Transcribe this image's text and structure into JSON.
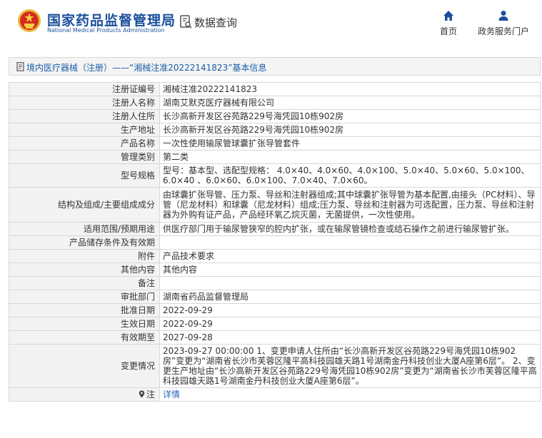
{
  "header": {
    "site_name": "国家药品监督管理局",
    "site_name_en": "National Medical Products Administration",
    "query_label": "数据查询",
    "nav": {
      "home": "首页",
      "service": "政务服务门户"
    }
  },
  "title": "境内医疗器械（注册）——“湘械注准20222141823”基本信息",
  "rows": [
    {
      "label": "注册证编号",
      "value": "湘械注准20222141823"
    },
    {
      "label": "注册人名称",
      "value": "湖南艾默克医疗器械有限公司"
    },
    {
      "label": "注册人住所",
      "value": "长沙高新开发区谷苑路229号海凭园10栋902房"
    },
    {
      "label": "生产地址",
      "value": "长沙高新开发区谷苑路229号海凭园10栋902房"
    },
    {
      "label": "产品名称",
      "value": "一次性使用输尿管球囊扩张导管套件"
    },
    {
      "label": "管理类别",
      "value": "第二类"
    },
    {
      "label": "型号规格",
      "value": "型号：基本型、选配型规格： 4.0×40、4.0×60、4.0×100、5.0×40、5.0×60、5.0×100、6.0×40 、6.0×60、6.0×100、7.0×40、7.0×60。"
    },
    {
      "label": "结构及组成/主要组成成分",
      "value": "由球囊扩张导管、压力泵、导丝和注射器组成;其中球囊扩张导管为基本配置,由接头（PC材料）、导管（尼龙材料）和球囊（尼龙材料）组成;压力泵、导丝和注射器为可选配置，压力泵、导丝和注射器为外购有证产品，产品经环氧乙烷灭菌，无菌提供，一次性使用。"
    },
    {
      "label": "适用范围/预期用途",
      "value": "供医疗部门用于输尿管狭窄的腔内扩张，或在输尿管镜检查或结石操作之前进行输尿管扩张。"
    },
    {
      "label": "产品储存条件及有效期",
      "value": ""
    },
    {
      "label": "附件",
      "value": "产品技术要求"
    },
    {
      "label": "其他内容",
      "value": "其他内容"
    },
    {
      "label": "备注",
      "value": ""
    },
    {
      "label": "审批部门",
      "value": "湖南省药品监督管理局"
    },
    {
      "label": "批准日期",
      "value": "2022-09-29"
    },
    {
      "label": "生效日期",
      "value": "2022-09-29"
    },
    {
      "label": "有效期至",
      "value": "2027-09-28"
    },
    {
      "label": "变更情况",
      "value": "2023-09-27 00:00:00 1、变更申请人住所由“长沙高新开发区谷苑路229号海凭园10栋902房”变更为“湖南省长沙市芙蓉区隆平高科技园雄天路1号湖南金丹科技创业大厦A座第6层”。 2、变更生产地址由“长沙高新开发区谷苑路229号海凭园10栋902房”变更为“湖南省长沙市芙蓉区隆平高科技园雄天路1号湖南金丹科技创业大厦A座第6层”。"
    }
  ],
  "note_row": {
    "label": "注",
    "link": "详情"
  },
  "colors": {
    "brand": "#1a4f9c",
    "link": "#2a63b8",
    "title_text": "#1a5fa6",
    "label_bg": "#f3f3f3",
    "border": "#d7d7d7"
  },
  "icons": {
    "emblem": "national-emblem-icon",
    "query": "document-search-icon",
    "home": "home-icon",
    "service": "user-icon",
    "title": "document-icon",
    "note": "location-pin-icon"
  }
}
